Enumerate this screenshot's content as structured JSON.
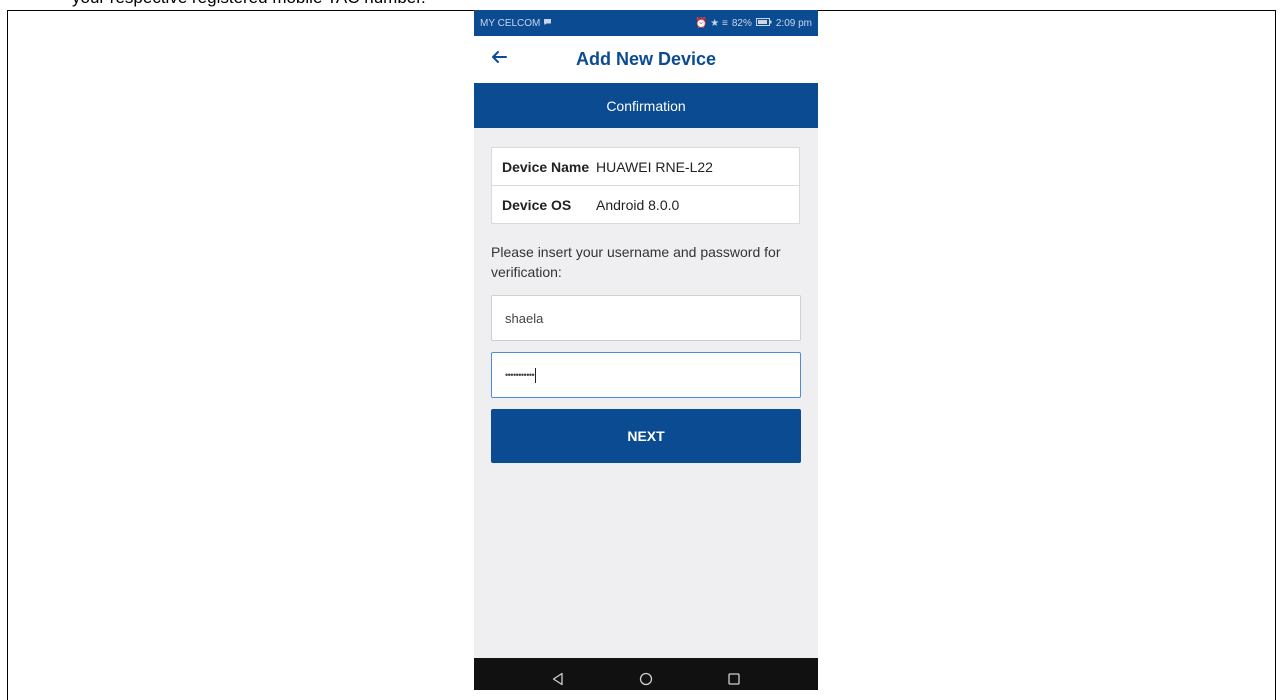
{
  "document": {
    "caption": "your respective registered mobile TAC number."
  },
  "statusbar": {
    "carrier": "MY CELCOM",
    "indicators": "⏰ ★ ≡",
    "battery": "82%",
    "time": "2:09 pm"
  },
  "appbar": {
    "title": "Add New Device",
    "back_icon": "back-arrow-icon"
  },
  "step": {
    "label": "Confirmation"
  },
  "device_info": {
    "rows": [
      {
        "key": "Device Name",
        "value": "HUAWEI RNE-L22"
      },
      {
        "key": "Device OS",
        "value": "Android 8.0.0"
      }
    ]
  },
  "form": {
    "prompt": "Please insert your username and password for verification:",
    "username_value": "shaela",
    "password_value": "•••••••••••",
    "next_label": "NEXT"
  },
  "colors": {
    "brand": "#0b4b92",
    "background": "#efeff1",
    "focus": "#4a8ed6"
  }
}
